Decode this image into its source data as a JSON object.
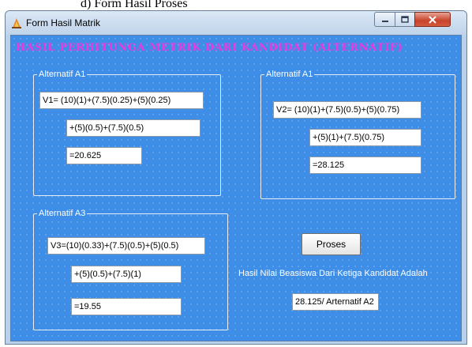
{
  "caption": "d)  Form Hasil Proses",
  "window": {
    "title": "Form Hasil Matrik",
    "icons": {
      "app": "app-icon",
      "minimize": "minimize-icon",
      "maximize": "maximize-icon",
      "close": "close-icon"
    }
  },
  "heading": "HASIL PERHITUNGA METRIK DARI KANDIDAT (ALTERNATIF)",
  "groups": {
    "a1_left": {
      "title": "Alternatif A1",
      "line1": "V1= (10)(1)+(7.5)(0.25)+(5)(0.25)",
      "line2": "+(5)(0.5)+(7.5)(0.5)",
      "result": "=20.625"
    },
    "a1_right": {
      "title": "Alternatif A1",
      "line1": "V2= (10)(1)+(7.5)(0.5)+(5)(0.75)",
      "line2": "+(5)(1)+(7.5)(0.75)",
      "result": "=28.125"
    },
    "a3": {
      "title": "Alternatif A3",
      "line1": "V3=(10)(0.33)+(7.5)(0.5)+(5)(0.5)",
      "line2": "+(5)(0.5)+(7.5)(1)",
      "result": "=19.55"
    }
  },
  "proses_button": "Proses",
  "result_label": "Hasil Nilai Beasiswa Dari Ketiga Kandidat Adalah",
  "result_value": "28.125/ Arternatif A2",
  "colors": {
    "client_bg": "#3e8ee8",
    "heading": "#e83adf",
    "close_button": "#c7432a"
  }
}
